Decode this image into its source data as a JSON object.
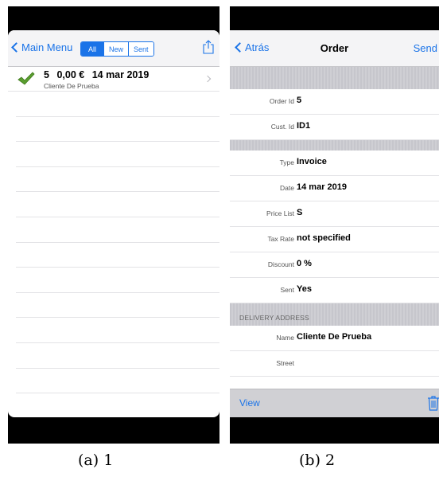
{
  "left": {
    "nav": {
      "back_label": "Main Menu",
      "segments": [
        {
          "label": "All",
          "active": true
        },
        {
          "label": "New",
          "active": false
        },
        {
          "label": "Sent",
          "active": false
        }
      ],
      "share_icon": "share-icon"
    },
    "order": {
      "number": "5",
      "amount": "0,00 €",
      "date": "14 mar 2019",
      "customer": "Cliente De Prueba",
      "status_icon": "checkmark-icon"
    }
  },
  "right": {
    "nav": {
      "back_label": "Atrás",
      "title": "Order",
      "action_label": "Send"
    },
    "fields": {
      "order_id": {
        "label": "Order Id",
        "value": "5"
      },
      "cust_id": {
        "label": "Cust. Id",
        "value": "ID1"
      },
      "type": {
        "label": "Type",
        "value": "Invoice"
      },
      "date": {
        "label": "Date",
        "value": "14 mar 2019"
      },
      "price_list": {
        "label": "Price List",
        "value": "S"
      },
      "tax_rate": {
        "label": "Tax Rate",
        "value": "not specified"
      },
      "discount": {
        "label": "Discount",
        "value": "0 %"
      },
      "sent": {
        "label": "Sent",
        "value": "Yes"
      }
    },
    "delivery": {
      "header": "DELIVERY ADDRESS",
      "name": {
        "label": "Name",
        "value": "Cliente De Prueba"
      },
      "street": {
        "label": "Street",
        "value": ""
      }
    },
    "toolbar": {
      "view_label": "View",
      "trash_icon": "trash-icon"
    }
  },
  "captions": {
    "a": "(a) 1",
    "b": "(b) 2"
  },
  "colors": {
    "accent": "#1a73e8",
    "check": "#5a9e2f",
    "nav_bg": "#f4f4f6",
    "section_bg": "#cfcfd4"
  }
}
